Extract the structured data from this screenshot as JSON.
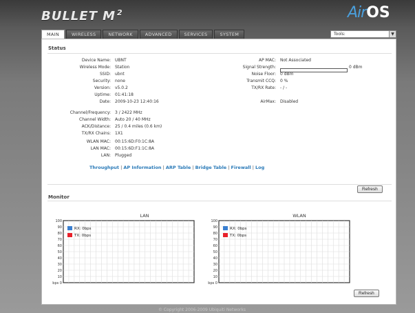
{
  "header": {
    "product": "BULLET M",
    "product_sup": "2",
    "brand_air": "Air",
    "brand_os": "OS"
  },
  "tabs": [
    "MAIN",
    "WIRELESS",
    "NETWORK",
    "ADVANCED",
    "SERVICES",
    "SYSTEM"
  ],
  "tools": {
    "label": "Tools:"
  },
  "status": {
    "title": "Status",
    "left": [
      {
        "label": "Device Name:",
        "value": "UBNT"
      },
      {
        "label": "Wireless Mode:",
        "value": "Station"
      },
      {
        "label": "SSID:",
        "value": "ubnt"
      },
      {
        "label": "Security:",
        "value": "none"
      },
      {
        "label": "Version:",
        "value": "v5.0.2"
      },
      {
        "label": "Uptime:",
        "value": "01:41:18"
      },
      {
        "label": "Date:",
        "value": "2009-10-23 12:40:16"
      },
      {
        "label": "Channel/Frequency:",
        "value": "3 / 2422 MHz"
      },
      {
        "label": "Channel Width:",
        "value": "Auto 20 / 40 MHz"
      },
      {
        "label": "ACK/Distance:",
        "value": "25 / 0.4 miles (0.6 km)"
      },
      {
        "label": "TX/RX Chains:",
        "value": "1X1"
      },
      {
        "label": "WLAN MAC:",
        "value": "00:15:6D:F0:1C:8A"
      },
      {
        "label": "LAN MAC:",
        "value": "00:15:6D:F1:1C:8A"
      },
      {
        "label": "LAN:",
        "value": "Plugged"
      }
    ],
    "right": [
      {
        "label": "AP MAC:",
        "value": "Not Associated"
      },
      {
        "label": "Signal Strength:",
        "value": "0 dBm"
      },
      {
        "label": "Noise Floor:",
        "value": "0 dBm"
      },
      {
        "label": "Transmit CCQ:",
        "value": "0 %"
      },
      {
        "label": "TX/RX Rate:",
        "value": "- / -"
      },
      {
        "label": "AirMax:",
        "value": "Disabled"
      }
    ],
    "signal_level": 0,
    "refresh": "Refresh"
  },
  "monitor": {
    "title": "Monitor",
    "links": [
      "Throughput",
      "AP Information",
      "ARP Table",
      "Bridge Table",
      "Firewall",
      "Log"
    ],
    "refresh": "Refresh"
  },
  "chart_data": [
    {
      "type": "line",
      "title": "LAN",
      "yticks": [
        "100",
        "90",
        "80",
        "70",
        "60",
        "50",
        "40",
        "30",
        "20",
        "10",
        "bps 0"
      ],
      "ylim": [
        0,
        100
      ],
      "series": [
        {
          "name": "RX: 0bps",
          "color": "#3a7fd0",
          "values": []
        },
        {
          "name": "TX: 0bps",
          "color": "#e8202a",
          "values": []
        }
      ],
      "grid": true,
      "legend": "top-left"
    },
    {
      "type": "line",
      "title": "WLAN",
      "yticks": [
        "100",
        "90",
        "80",
        "70",
        "60",
        "50",
        "40",
        "30",
        "20",
        "10",
        "bps 0"
      ],
      "ylim": [
        0,
        100
      ],
      "series": [
        {
          "name": "RX: 0bps",
          "color": "#3a7fd0",
          "values": []
        },
        {
          "name": "TX: 0bps",
          "color": "#e8202a",
          "values": []
        }
      ],
      "grid": true,
      "legend": "top-left"
    }
  ],
  "footer": "© Copyright 2006-2009 Ubiquiti Networks"
}
